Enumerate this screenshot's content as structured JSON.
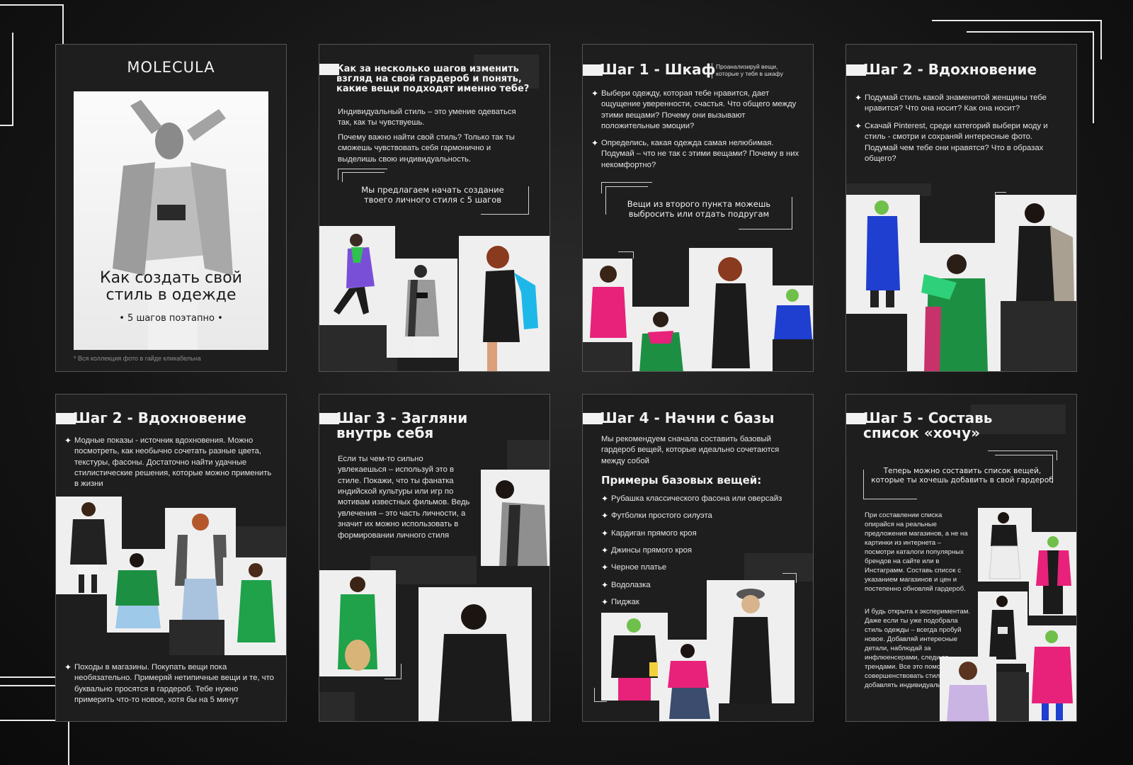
{
  "cover": {
    "logo": "MOLECULA",
    "title_line1": "Как создать свой",
    "title_line2": "стиль в одежде",
    "subtitle": "• 5 шагов поэтапно •",
    "footnote": "* Вся коллекция фото в гайде кликабельна"
  },
  "intro": {
    "title": "Как за несколько шагов изменить взгляд на свой гардероб и понять, какие вещи подходят именно тебе?",
    "p1": "Индивидуальный стиль – это умение одеваться так, как ты чувствуешь.",
    "p2": "Почему важно найти свой стиль? Только так ты сможешь чувствовать себя гармонично и выделишь свою индивидуальность.",
    "callout": "Мы предлагаем начать создание твоего личного стиля с 5 шагов"
  },
  "step1": {
    "title": "Шаг 1 - Шкаф",
    "side_note": "Проанализируй вещи, которые у тебя в шкафу",
    "b1": "Выбери одежду, которая тебе нравится, дает ощущение уверенности, счастья. Что общего между этими вещами? Почему они вызывают положительные эмоции?",
    "b2": "Определись, какая одежда самая нелюбимая. Подумай – что не так с этими вещами? Почему в них некомфортно?",
    "callout": "Вещи из второго пункта можешь выбросить или отдать подругам"
  },
  "step2a": {
    "title": "Шаг 2 - Вдохновение",
    "b1": "Подумай стиль какой знаменитой женщины тебе нравится? Что она носит? Как она носит?",
    "b2": "Скачай Pinterest, среди категорий выбери моду и стиль - смотри и сохраняй интересные фото. Подумай чем тебе они нравятся? Что в образах общего?"
  },
  "step2b": {
    "title": "Шаг 2 - Вдохновение",
    "b1": "Модные показы - источник вдохновения. Можно посмотреть, как необычно сочетать разные цвета, текстуры, фасоны. Достаточно найти удачные стилистические решения, которые можно применить в жизни",
    "b2": "Походы в магазины. Покупать вещи пока необязательно. Примеряй нетипичные вещи и те, что буквально просятся в гардероб. Тебе нужно примерить что-то новое, хотя бы на 5 минут"
  },
  "step3": {
    "title_line1": "Шаг 3 - Загляни",
    "title_line2": "внутрь себя",
    "body": "Если ты чем-то сильно увлекаешься – используй это в стиле. Покажи, что ты фанатка индийской культуры или игр по мотивам известных фильмов. Ведь увлечения – это часть личности, а значит их можно использовать в формировании личного стиля"
  },
  "step4": {
    "title": "Шаг 4 - Начни с базы",
    "intro": "Мы рекомендуем сначала составить базовый гардероб вещей, которые идеально сочетаются между собой",
    "subtitle": "Примеры базовых вещей:",
    "items": [
      "Рубашка классического фасона или оверсайз",
      "Футболки простого силуэта",
      "Кардиган прямого кроя",
      "Джинсы прямого кроя",
      "Черное платье",
      "Водолазка",
      "Пиджак"
    ]
  },
  "step5": {
    "title_line1": "Шаг 5 - Составь",
    "title_line2": "список «хочу»",
    "callout": "Теперь можно составить список вещей, которые ты хочешь добавить в свой гардероб",
    "p1": "При составлении списка опирайся на реальные предложения магазинов, а не на картинки из интернета – посмотри каталоги популярных брендов на сайте или в Инстаграмм. Составь список с указанием магазинов и цен и постепенно обновляй гардероб.",
    "p2": "И будь открыта к экспериментам. Даже если ты уже подобрала стиль одежды – всегда пробуй новое. Добавляй интересные детали, наблюдай за инфлюенсерами, следи за трендами. Все это помогает совершенствовать стиль и добавлять индивидуальность."
  },
  "colors": {
    "page_bg": "#1f1e1e",
    "accent_green": "#1fa24a",
    "accent_blue": "#1f3fd0",
    "accent_pink": "#e8217a",
    "accent_purple": "#7a4fd8",
    "accent_cyan": "#1db8e8"
  },
  "icons": [
    "star-bullet-icon"
  ]
}
